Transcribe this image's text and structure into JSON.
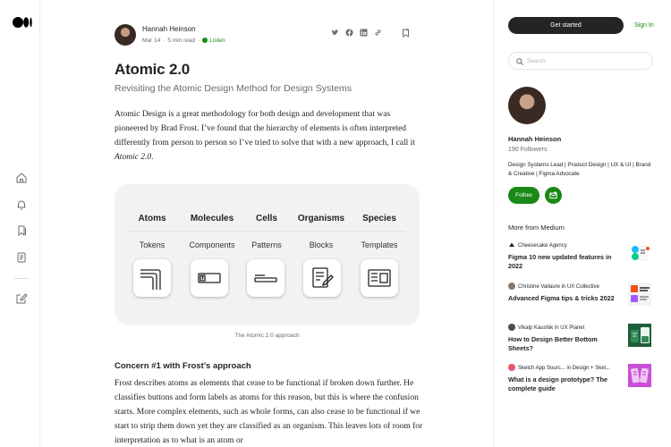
{
  "nav": {
    "logo": "Medium",
    "icons": [
      "home-icon",
      "notifications-icon",
      "lists-icon",
      "stories-icon",
      "write-icon"
    ]
  },
  "article": {
    "author": "Hannah Heinson",
    "date": "Mar 14",
    "read_time": "5 min read",
    "listen": "Listen",
    "title": "Atomic 2.0",
    "subtitle": "Revisiting the Atomic Design Method for Design Systems",
    "intro_before": "Atomic Design is a great methodology for both design and development that was pioneered by Brad Frost. I’ve found that the hierarchy of elements is often interpreted differently from person to person so I’ve tried to solve that with a new approach, I call it ",
    "intro_em": "Atomic 2.0",
    "intro_after": ".",
    "figure": {
      "columns": [
        {
          "head": "Atoms",
          "sub": "Tokens",
          "icon": "tokens-icon"
        },
        {
          "head": "Molecules",
          "sub": "Components",
          "icon": "component-icon"
        },
        {
          "head": "Cells",
          "sub": "Patterns",
          "icon": "pattern-icon"
        },
        {
          "head": "Organisms",
          "sub": "Blocks",
          "icon": "block-icon"
        },
        {
          "head": "Species",
          "sub": "Templates",
          "icon": "template-icon"
        }
      ],
      "caption": "The Atomic 2.0 approach"
    },
    "concern_heading": "Concern #1 with Frost’s approach",
    "concern_text": "Frost describes atoms as elements that cease to be functional if broken down further. He classifies buttons and form labels as atoms for this reason, but this is where the confusion starts. More complex elements, such as whole forms, can also cease to be functional if we start to strip them down yet they are classified as an organism. This leaves lots of room for interpretation as to what is an atom or"
  },
  "sidebar": {
    "get_started": "Get started",
    "sign_in": "Sign In",
    "search_placeholder": "Search",
    "author_name": "Hannah Heinson",
    "followers": "190 Followers",
    "bio": "Design Systems Lead | Product Design | UX & UI | Brand & Creative | Figma Advocate",
    "follow": "Follow",
    "more_heading": "More from Medium",
    "stories": [
      {
        "pub": "Cheesecake Agency",
        "title": "Figma 10 new updated features in 2022",
        "pub_color": "#f2f2f2"
      },
      {
        "pub": "Christine Vallaure in UX Collective",
        "title": "Advanced Figma tips & tricks 2022",
        "pub_color": "#8a7a6e"
      },
      {
        "pub": "Vikalp Kaushik in UX Planet",
        "title": "How to Design Better Bottom Sheets?",
        "pub_color": "#5a4a40"
      },
      {
        "pub": "Sketch App Sourc... in Design + Sket...",
        "title": "What is a design prototype? The complete guide",
        "pub_color": "#e8566b"
      }
    ]
  },
  "colors": {
    "accent": "#1a8917",
    "text": "#242424",
    "muted": "#6b6b6b"
  }
}
